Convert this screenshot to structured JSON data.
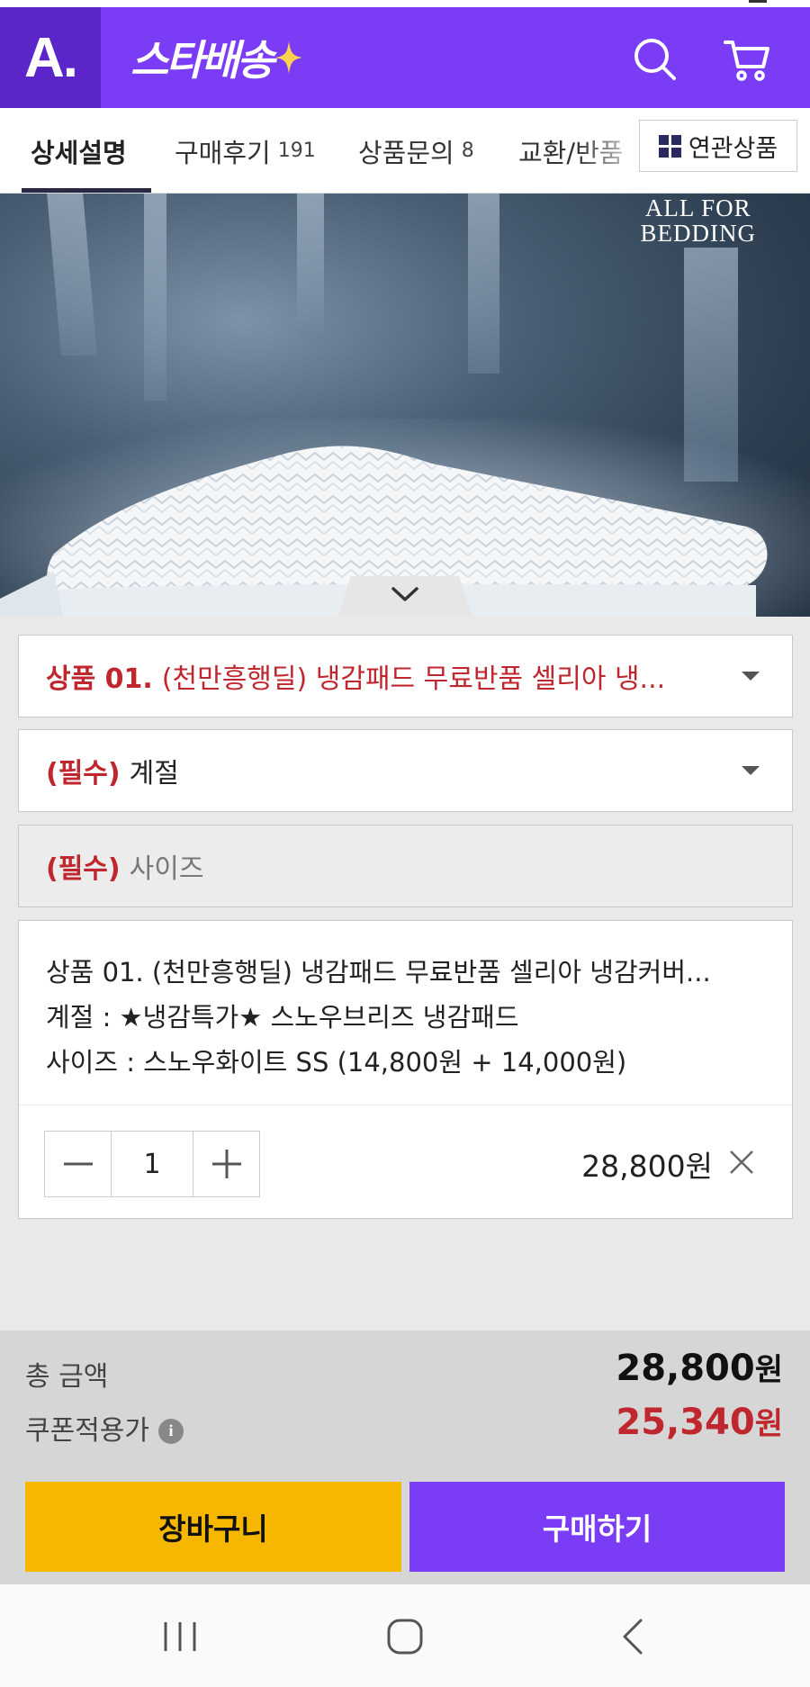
{
  "header": {
    "logo_text": "A.",
    "service_text": "스타배송",
    "accent_color": "#7a3cf5",
    "icons": [
      "search-icon",
      "cart-icon"
    ]
  },
  "tabs": {
    "detail": "상세설명",
    "reviews": "구매후기",
    "reviews_count": "191",
    "inquiry": "상품문의",
    "inquiry_count": "8",
    "exchange": "교환/반품",
    "related": "연관상품"
  },
  "hero": {
    "brand_line1": "ALL FOR",
    "brand_line2": "BEDDING"
  },
  "options": {
    "product": {
      "prefix": "상품 01.",
      "value": "(천만흥행딜) 냉감패드 무료반품 셀리아 냉..."
    },
    "season": {
      "required": "(필수)",
      "value": "계절"
    },
    "size": {
      "required": "(필수)",
      "placeholder": "사이즈"
    }
  },
  "selected": {
    "line1": "상품 01. (천만흥행딜) 냉감패드 무료반품 셀리아 냉감커버...",
    "line2": "계절 : ★냉감특가★ 스노우브리즈 냉감패드",
    "line3": "사이즈 : 스노우화이트 SS (14,800원 + 14,000원)",
    "quantity": "1",
    "price": "28,800원"
  },
  "footer": {
    "total_label": "총 금액",
    "total_value": "28,800",
    "coupon_label": "쿠폰적용가",
    "coupon_value": "25,340",
    "currency": "원",
    "cart_button": "장바구니",
    "buy_button": "구매하기",
    "cart_color": "#f5b700",
    "buy_color": "#7a3cf5",
    "price_red": "#c0262d"
  }
}
